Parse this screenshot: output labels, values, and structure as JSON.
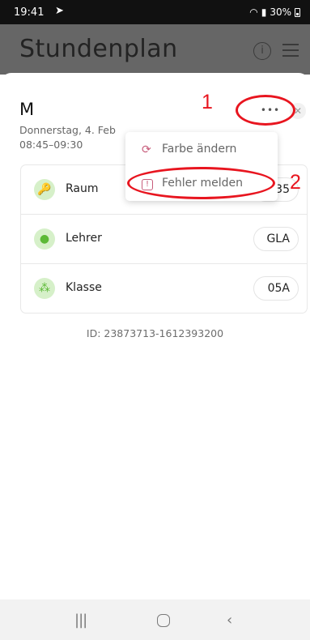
{
  "status_bar": {
    "time": "19:41",
    "battery": "30%"
  },
  "header": {
    "title": "Stundenplan",
    "info_icon": "info-icon",
    "menu_icon": "hamburger-menu-icon"
  },
  "lesson": {
    "letter": "M",
    "date": "Donnerstag, 4. Feb",
    "time": "08:45–09:30",
    "more_label": "•••",
    "close_label": "✕"
  },
  "info_rows": [
    {
      "label": "Raum",
      "value": "35",
      "icon": "key-icon"
    },
    {
      "label": "Lehrer",
      "value": "GLA",
      "icon": "person-icon"
    },
    {
      "label": "Klasse",
      "value": "05A",
      "icon": "group-icon"
    }
  ],
  "lesson_id": "ID: 23873713-1612393200",
  "popup_menu": {
    "items": [
      {
        "label": "Farbe ändern",
        "icon": "refresh-color-icon"
      },
      {
        "label": "Fehler melden",
        "icon": "report-error-icon"
      }
    ]
  },
  "annotations": {
    "first": "1",
    "second": "2"
  },
  "colors": {
    "accent_green": "#5cb936",
    "annotation_red": "#e8151f",
    "menu_icon_pink": "#c75b7a"
  }
}
